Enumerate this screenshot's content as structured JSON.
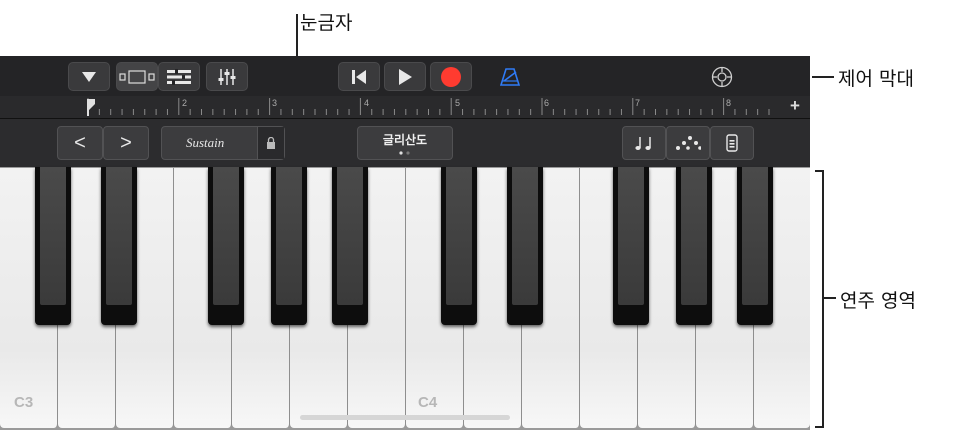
{
  "callouts": {
    "ruler": "눈금자",
    "control_bar": "제어 막대",
    "play_area": "연주 영역"
  },
  "ruler": {
    "marks": [
      "2",
      "3",
      "4",
      "5",
      "6",
      "7",
      "8"
    ],
    "add_label": "+"
  },
  "toolbar": {
    "icons": [
      "browser-menu-icon",
      "tracks-view-icon",
      "track-controls-icon",
      "mixer-icon",
      "go-to-beginning-icon",
      "play-icon",
      "record-icon",
      "metronome-icon",
      "settings-icon"
    ],
    "accent": "#ff3b30",
    "metronome_color": "#2f7bf5"
  },
  "controls": {
    "octave_down": "<",
    "octave_up": ">",
    "sustain": "Sustain",
    "glissando": "글리산도",
    "scroll_mode_icons": [
      "notes-icon",
      "arpeggiator-icon",
      "velocity-icon"
    ]
  },
  "keyboard": {
    "labels": [
      "C3",
      "C4"
    ]
  }
}
